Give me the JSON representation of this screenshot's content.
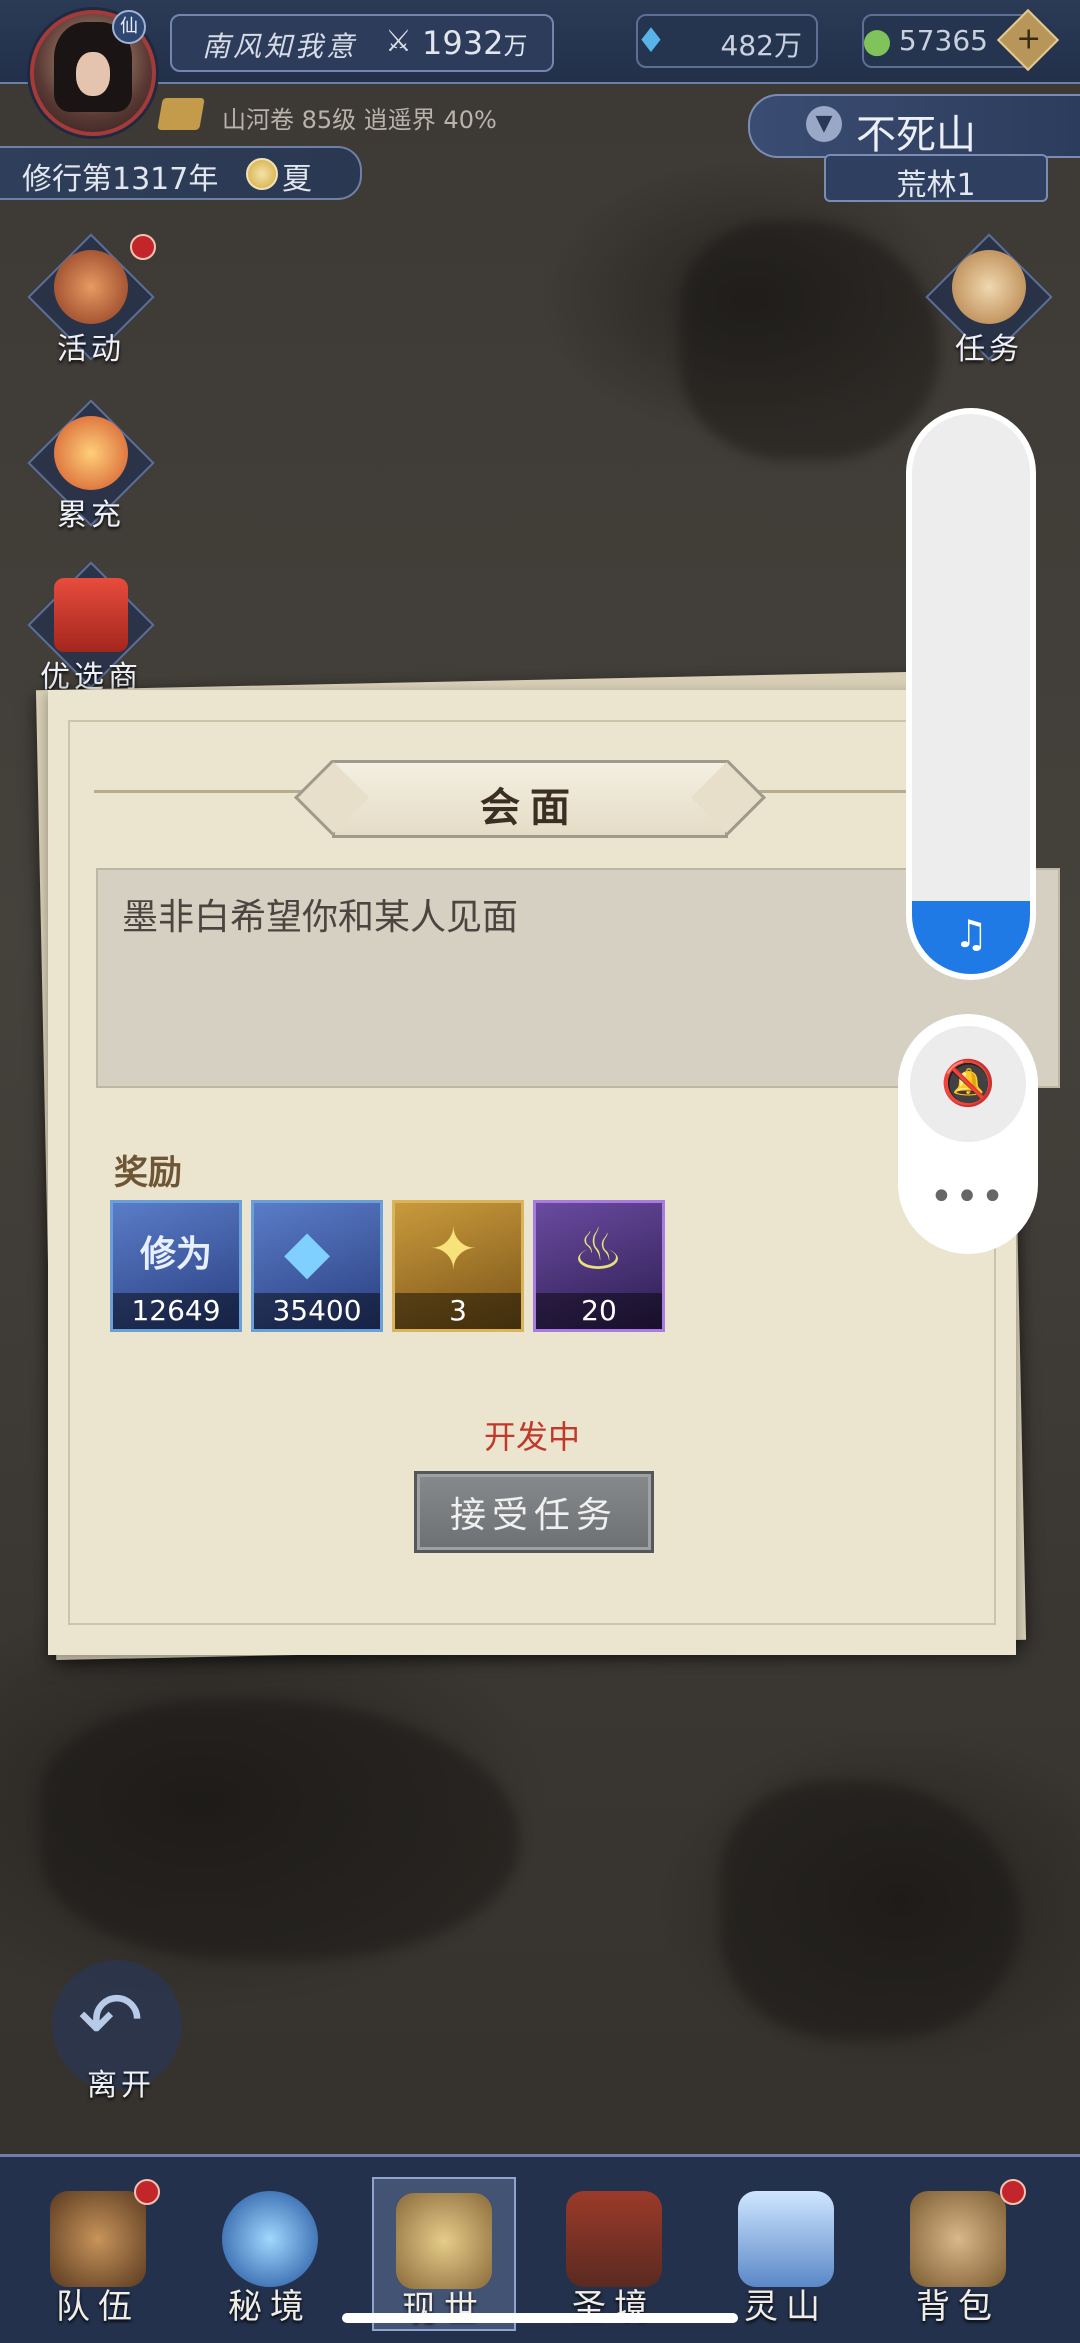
{
  "header": {
    "badge": "仙",
    "player_name": "南风知我意",
    "power_value": "1932",
    "power_unit": "万",
    "resource_crystal": "482万",
    "resource_jade": "57365",
    "plus": "+",
    "sub_info": "山河卷 85级 逍遥界 40%",
    "cultivation_year": "修行第1317年",
    "season": "夏",
    "location": "不死山",
    "sub_location": "荒林1"
  },
  "side_left": [
    {
      "label": "活动"
    },
    {
      "label": "累充"
    },
    {
      "label": "优选商城"
    }
  ],
  "side_right": [
    {
      "label": "任务"
    }
  ],
  "dialog": {
    "title": "会面",
    "description": "墨非白希望你和某人见面",
    "rewards_label": "奖励",
    "rewards": [
      {
        "name": "修为",
        "count": "12649"
      },
      {
        "name": "crystal",
        "count": "35400"
      },
      {
        "name": "gem",
        "count": "3"
      },
      {
        "name": "flame",
        "count": "20"
      }
    ],
    "status": "开发中",
    "accept_label": "接受任务"
  },
  "leave_label": "离开",
  "bottom_nav": [
    {
      "label": "队伍"
    },
    {
      "label": "秘境"
    },
    {
      "label": "现世"
    },
    {
      "label": "圣境"
    },
    {
      "label": "灵山"
    },
    {
      "label": "背包"
    }
  ],
  "overlay": {
    "volume_level": 0.13,
    "note_icon": "♫",
    "more": "•••"
  }
}
